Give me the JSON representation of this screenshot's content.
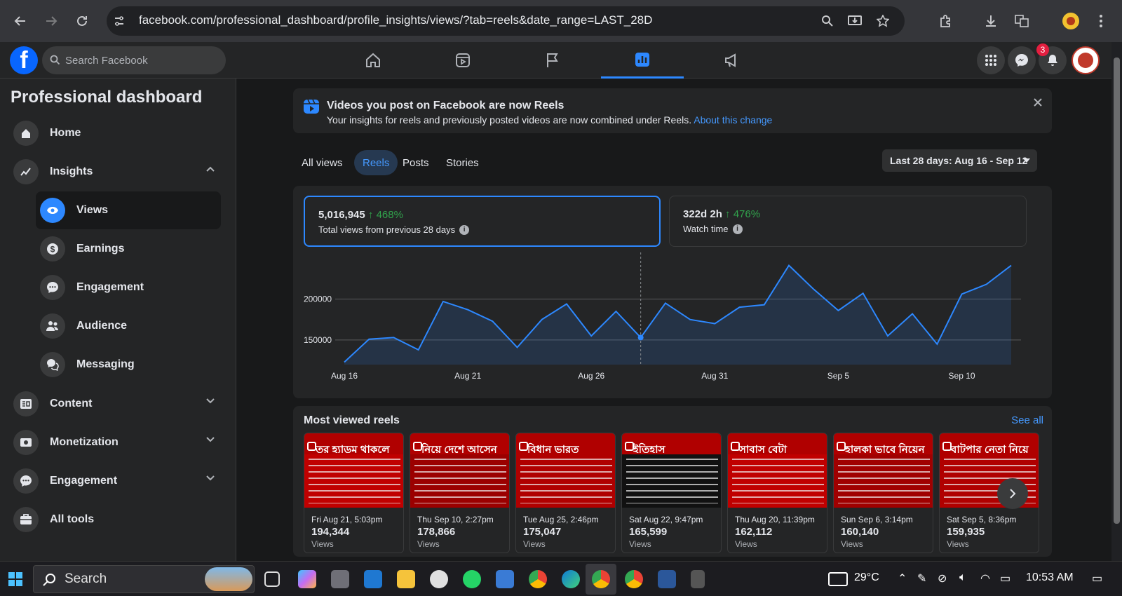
{
  "browser": {
    "url": "facebook.com/professional_dashboard/profile_insights/views/?tab=reels&date_range=LAST_28D"
  },
  "fb": {
    "logo": "f",
    "search_placeholder": "Search Facebook",
    "nav_tabs": [
      "home-icon",
      "video-icon",
      "flag-icon",
      "insights-icon",
      "megaphone-icon"
    ],
    "active_tab": "insights-icon",
    "notifications_count": "3"
  },
  "sidebar": {
    "title": "Professional dashboard",
    "items": [
      {
        "label": "Home",
        "icon": "home-icon"
      },
      {
        "label": "Insights",
        "icon": "insights-trend-icon",
        "expanded": true
      },
      {
        "label": "Views",
        "icon": "eye-icon",
        "sub": true,
        "active": true
      },
      {
        "label": "Earnings",
        "icon": "dollar-icon",
        "sub": true
      },
      {
        "label": "Engagement",
        "icon": "chat-icon",
        "sub": true
      },
      {
        "label": "Audience",
        "icon": "people-icon",
        "sub": true
      },
      {
        "label": "Messaging",
        "icon": "messages-icon",
        "sub": true
      },
      {
        "label": "Content",
        "icon": "content-icon"
      },
      {
        "label": "Monetization",
        "icon": "money-icon"
      },
      {
        "label": "Engagement",
        "icon": "chat-icon"
      },
      {
        "label": "All tools",
        "icon": "toolbox-icon"
      }
    ]
  },
  "banner": {
    "title": "Videos you post on Facebook are now Reels",
    "text": "Your insights for reels and previously posted videos are now combined under Reels. ",
    "link": "About this change"
  },
  "filter_tabs": [
    "All views",
    "Reels",
    "Posts",
    "Stories"
  ],
  "active_filter": "Reels",
  "date_range": "Last 28 days: Aug 16 - Sep 12",
  "metrics": [
    {
      "value": "5,016,945",
      "change": "↑ 468%",
      "label": "Total views from previous 28 days",
      "selected": true
    },
    {
      "value": "322d 2h",
      "change": "↑ 476%",
      "label": "Watch time",
      "selected": false
    }
  ],
  "chart_data": {
    "type": "area",
    "x": [
      "Aug 16",
      "Aug 17",
      "Aug 18",
      "Aug 19",
      "Aug 20",
      "Aug 21",
      "Aug 22",
      "Aug 23",
      "Aug 24",
      "Aug 25",
      "Aug 26",
      "Aug 27",
      "Aug 28",
      "Aug 29",
      "Aug 30",
      "Aug 31",
      "Sep 1",
      "Sep 2",
      "Sep 3",
      "Sep 4",
      "Sep 5",
      "Sep 6",
      "Sep 7",
      "Sep 8",
      "Sep 9",
      "Sep 10",
      "Sep 11",
      "Sep 12"
    ],
    "values": [
      123000,
      151000,
      153000,
      138000,
      197000,
      187000,
      173000,
      141000,
      175000,
      194000,
      155000,
      185000,
      153000,
      195000,
      175000,
      170000,
      190000,
      193000,
      241000,
      212000,
      186000,
      207000,
      155000,
      182000,
      145000,
      206000,
      218000,
      241000
    ],
    "x_ticks": [
      "Aug 16",
      "Aug 21",
      "Aug 26",
      "Aug 31",
      "Sep 5",
      "Sep 10"
    ],
    "y_ticks": [
      150000,
      200000
    ],
    "y_tick_labels": [
      "150000",
      "200000"
    ],
    "ylim": [
      120000,
      250000
    ],
    "grid": true,
    "highlight_index": 12,
    "color": "#2d88ff"
  },
  "reels": {
    "title": "Most viewed reels",
    "see_all": "See all",
    "items": [
      {
        "date": "Fri Aug 21, 5:03pm",
        "count": "194,344",
        "label": "Views",
        "headline": "তর হ্যাডম থাকলে",
        "color": "#c00000"
      },
      {
        "date": "Thu Sep 10, 2:27pm",
        "count": "178,866",
        "label": "Views",
        "headline": "নিয়ে দেশে আসেন",
        "color": "#9b0000"
      },
      {
        "date": "Tue Aug 25, 2:46pm",
        "count": "175,047",
        "label": "Views",
        "headline": "বিধান ভারত",
        "color": "#b00000"
      },
      {
        "date": "Sat Aug 22, 9:47pm",
        "count": "165,599",
        "label": "Views",
        "headline": "ইতিহাস",
        "color": "#111111"
      },
      {
        "date": "Thu Aug 20, 11:39pm",
        "count": "162,112",
        "label": "Views",
        "headline": "সাবাস বেটা",
        "color": "#c00000"
      },
      {
        "date": "Sun Sep 6, 3:14pm",
        "count": "160,140",
        "label": "Views",
        "headline": "হালকা ভাবে নিয়েন",
        "color": "#a00000"
      },
      {
        "date": "Sat Sep 5, 8:36pm",
        "count": "159,935",
        "label": "Views",
        "headline": "বাটপার নেতা নিয়ে",
        "color": "#b00000"
      }
    ]
  },
  "taskbar": {
    "search_placeholder": "Search",
    "temperature": "29°C",
    "time": "10:53 AM"
  }
}
